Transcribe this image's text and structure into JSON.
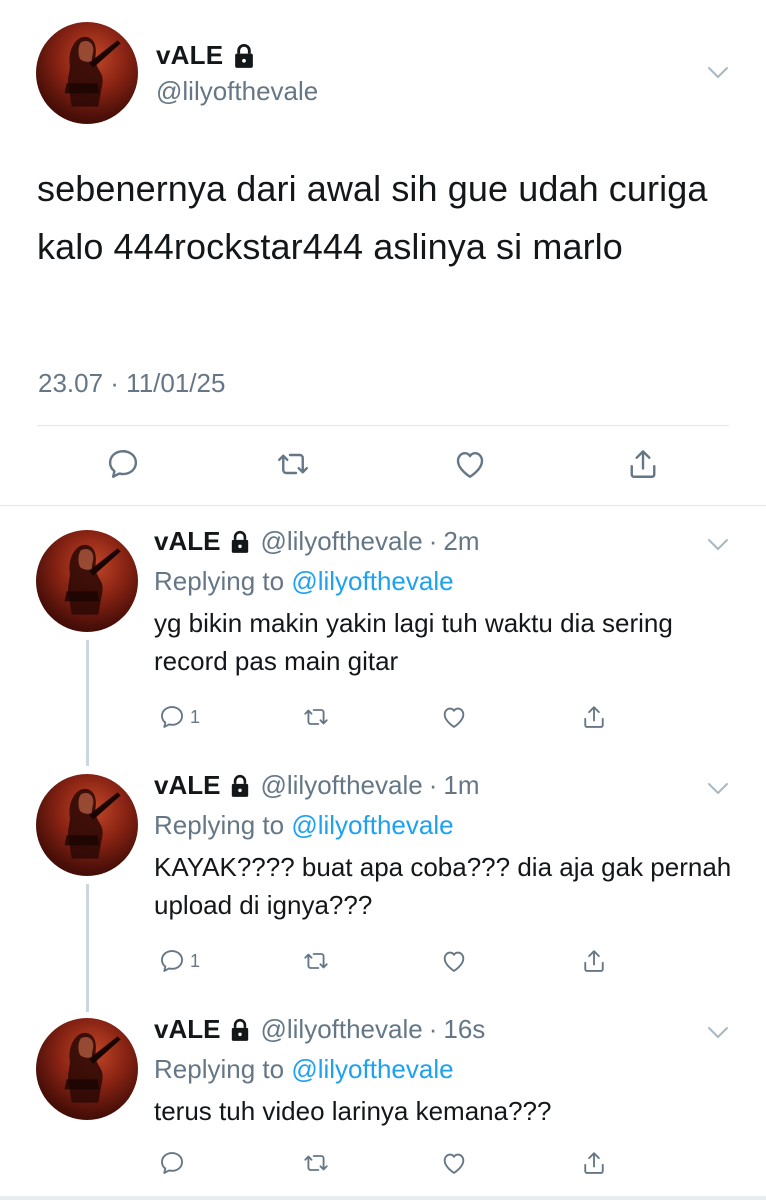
{
  "main_tweet": {
    "name": "vALE",
    "handle": "@lilyofthevale",
    "text": "sebenernya dari awal sih gue udah curiga kalo 444rockstar444 aslinya si marlo",
    "timestamp": "23.07 · 11/01/25",
    "icons": [
      "lock-icon",
      "chevron-down-icon",
      "reply-icon",
      "retweet-icon",
      "like-icon",
      "share-icon"
    ]
  },
  "replies": [
    {
      "name": "vALE",
      "handle": "@lilyofthevale",
      "dot": "·",
      "time": "2m",
      "replying_prefix": "Replying to ",
      "replying_to": "@lilyofthevale",
      "text": "yg bikin makin yakin lagi tuh waktu dia sering record pas main gitar",
      "reply_count": "1"
    },
    {
      "name": "vALE",
      "handle": "@lilyofthevale",
      "dot": "·",
      "time": "1m",
      "replying_prefix": "Replying to ",
      "replying_to": "@lilyofthevale",
      "text": "KAYAK???? buat apa coba??? dia aja gak pernah upload di ignya???",
      "reply_count": "1"
    },
    {
      "name": "vALE",
      "handle": "@lilyofthevale",
      "dot": "·",
      "time": "16s",
      "replying_prefix": "Replying to ",
      "replying_to": "@lilyofthevale",
      "text": "terus tuh video larinya kemana???",
      "reply_count": ""
    }
  ],
  "colors": {
    "text": "#14171a",
    "secondary": "#657786",
    "link": "#1da1f2",
    "divider": "#e1e8ed",
    "thread_line": "#ccd6dd"
  }
}
